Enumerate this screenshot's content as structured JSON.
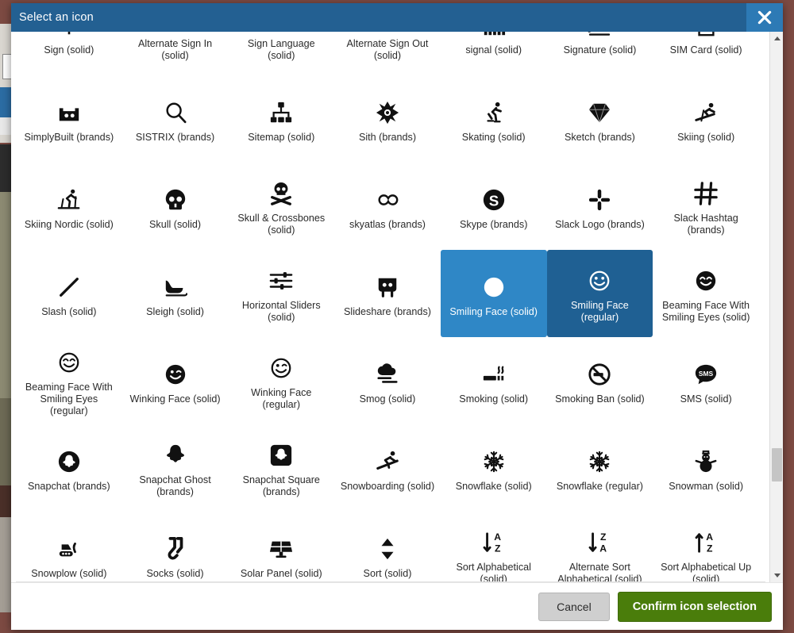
{
  "dialog": {
    "title": "Select an icon",
    "close_icon": "close-icon"
  },
  "footer": {
    "cancel_label": "Cancel",
    "confirm_label": "Confirm icon selection"
  },
  "colors": {
    "titlebar": "#236092",
    "close_button": "#2d7ab5",
    "tile_hovered": "#2f87c6",
    "tile_selected": "#1f6093",
    "confirm_button": "#4a7d0b",
    "cancel_button": "#cfcfcf",
    "scrollbar_thumb": "#c5c5c5"
  },
  "scrollbar": {
    "up_icon": "chevron-up-icon",
    "down_icon": "chevron-down-icon",
    "thumb_icon": "scroll-thumb"
  },
  "icons": [
    {
      "label": "Sign (solid)",
      "icon": "sign-icon",
      "state": "normal"
    },
    {
      "label": "Alternate Sign In (solid)",
      "icon": "sign-in-alt-icon",
      "state": "normal"
    },
    {
      "label": "Sign Language (solid)",
      "icon": "sign-language-icon",
      "state": "normal"
    },
    {
      "label": "Alternate Sign Out (solid)",
      "icon": "sign-out-alt-icon",
      "state": "normal"
    },
    {
      "label": "signal (solid)",
      "icon": "signal-icon",
      "state": "normal"
    },
    {
      "label": "Signature (solid)",
      "icon": "signature-icon",
      "state": "normal"
    },
    {
      "label": "SIM Card (solid)",
      "icon": "sim-card-icon",
      "state": "normal"
    },
    {
      "label": "SimplyBuilt (brands)",
      "icon": "simplybuilt-icon",
      "state": "normal"
    },
    {
      "label": "SISTRIX (brands)",
      "icon": "sistrix-icon",
      "state": "normal"
    },
    {
      "label": "Sitemap (solid)",
      "icon": "sitemap-icon",
      "state": "normal"
    },
    {
      "label": "Sith (brands)",
      "icon": "sith-icon",
      "state": "normal"
    },
    {
      "label": "Skating (solid)",
      "icon": "skating-icon",
      "state": "normal"
    },
    {
      "label": "Sketch (brands)",
      "icon": "sketch-icon",
      "state": "normal"
    },
    {
      "label": "Skiing (solid)",
      "icon": "skiing-icon",
      "state": "normal"
    },
    {
      "label": "Skiing Nordic (solid)",
      "icon": "skiing-nordic-icon",
      "state": "normal"
    },
    {
      "label": "Skull (solid)",
      "icon": "skull-icon",
      "state": "normal"
    },
    {
      "label": "Skull & Crossbones (solid)",
      "icon": "skull-crossbones-icon",
      "state": "normal"
    },
    {
      "label": "skyatlas (brands)",
      "icon": "skyatlas-icon",
      "state": "normal"
    },
    {
      "label": "Skype (brands)",
      "icon": "skype-icon",
      "state": "normal"
    },
    {
      "label": "Slack Logo (brands)",
      "icon": "slack-icon",
      "state": "normal"
    },
    {
      "label": "Slack Hashtag (brands)",
      "icon": "slack-hash-icon",
      "state": "normal"
    },
    {
      "label": "Slash (solid)",
      "icon": "slash-icon",
      "state": "normal"
    },
    {
      "label": "Sleigh (solid)",
      "icon": "sleigh-icon",
      "state": "normal"
    },
    {
      "label": "Horizontal Sliders (solid)",
      "icon": "sliders-h-icon",
      "state": "normal"
    },
    {
      "label": "Slideshare (brands)",
      "icon": "slideshare-icon",
      "state": "normal"
    },
    {
      "label": "Smiling Face (solid)",
      "icon": "smile-solid-icon",
      "state": "hovered"
    },
    {
      "label": "Smiling Face (regular)",
      "icon": "smile-regular-icon",
      "state": "selected"
    },
    {
      "label": "Beaming Face With Smiling Eyes (solid)",
      "icon": "smile-beam-solid-icon",
      "state": "normal"
    },
    {
      "label": "Beaming Face With Smiling Eyes (regular)",
      "icon": "smile-beam-regular-icon",
      "state": "normal"
    },
    {
      "label": "Winking Face (solid)",
      "icon": "smile-wink-solid-icon",
      "state": "normal"
    },
    {
      "label": "Winking Face (regular)",
      "icon": "smile-wink-regular-icon",
      "state": "normal"
    },
    {
      "label": "Smog (solid)",
      "icon": "smog-icon",
      "state": "normal"
    },
    {
      "label": "Smoking (solid)",
      "icon": "smoking-icon",
      "state": "normal"
    },
    {
      "label": "Smoking Ban (solid)",
      "icon": "smoking-ban-icon",
      "state": "normal"
    },
    {
      "label": "SMS (solid)",
      "icon": "sms-icon",
      "state": "normal"
    },
    {
      "label": "Snapchat (brands)",
      "icon": "snapchat-icon",
      "state": "normal"
    },
    {
      "label": "Snapchat Ghost (brands)",
      "icon": "snapchat-ghost-icon",
      "state": "normal"
    },
    {
      "label": "Snapchat Square (brands)",
      "icon": "snapchat-square-icon",
      "state": "normal"
    },
    {
      "label": "Snowboarding (solid)",
      "icon": "snowboarding-icon",
      "state": "normal"
    },
    {
      "label": "Snowflake (solid)",
      "icon": "snowflake-solid-icon",
      "state": "normal"
    },
    {
      "label": "Snowflake (regular)",
      "icon": "snowflake-regular-icon",
      "state": "normal"
    },
    {
      "label": "Snowman (solid)",
      "icon": "snowman-icon",
      "state": "normal"
    },
    {
      "label": "Snowplow (solid)",
      "icon": "snowplow-icon",
      "state": "normal"
    },
    {
      "label": "Socks (solid)",
      "icon": "socks-icon",
      "state": "normal"
    },
    {
      "label": "Solar Panel (solid)",
      "icon": "solar-panel-icon",
      "state": "normal"
    },
    {
      "label": "Sort (solid)",
      "icon": "sort-icon",
      "state": "normal"
    },
    {
      "label": "Sort Alphabetical (solid)",
      "icon": "sort-alpha-down-icon",
      "state": "normal"
    },
    {
      "label": "Alternate Sort Alphabetical (solid)",
      "icon": "sort-alpha-down-alt-icon",
      "state": "normal"
    },
    {
      "label": "Sort Alphabetical Up (solid)",
      "icon": "sort-alpha-up-icon",
      "state": "normal"
    }
  ]
}
